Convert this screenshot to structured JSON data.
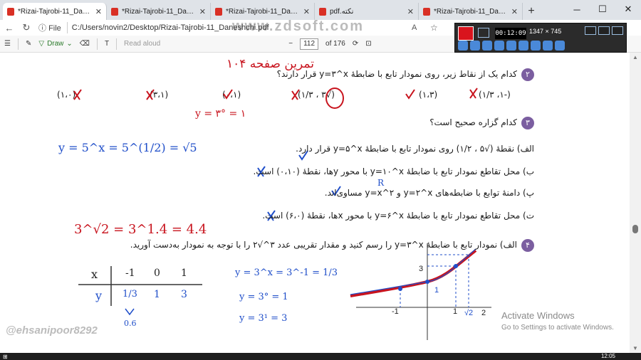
{
  "tabs": [
    {
      "title": "*Rizai-Tajrobi-11_Daneshchi.p",
      "active": true
    },
    {
      "title": "*Rizai-Tajrobi-11_Daneshchi.p",
      "active": false
    },
    {
      "title": "*Rizai-Tajrobi-11_Daneshchi.p",
      "active": false
    },
    {
      "title": "pdf.نکته",
      "active": false
    },
    {
      "title": "*Rizai-Tajrobi-11_Daneshchi.p",
      "active": false
    }
  ],
  "address": {
    "scheme_label": "File",
    "url": "C:/Users/novin2/Desktop/Rizai-Tajrobi-11_Daneshchi.pdf",
    "watermark": "www.zdsoft.com"
  },
  "pdf_toolbar": {
    "draw_label": "Draw",
    "read_aloud": "Read aloud",
    "page_current": "112",
    "page_total": "of 176"
  },
  "recorder": {
    "time": "00:12:09",
    "resolution": "1347 × 745"
  },
  "content": {
    "q2_text": "کدام یک از نقاط زیر، روی نمودار تابع با ضابطهٔ y=۳^x قرار دارند؟",
    "q2_num": "۲",
    "q2_options": [
      "(۱،۰)",
      "(۳،۱)",
      "(۰،۱)",
      "(√۳ ، ۱/۳)",
      "(۱،۳)",
      "(-۱، ۱/۳)"
    ],
    "q3_num": "۳",
    "q3_text": "کدام گزاره صحیح است؟",
    "q3_a": "الف) نقطهٔ (√۵ ، ۱/۲) روی نمودار تابع با ضابطهٔ y=۵^x قرار دارد.",
    "q3_b": "ب) محل تقاطع نمودار تابع با ضابطهٔ y=۱۰^x با محور yها، نقطهٔ (۰،۱۰) است.",
    "q3_p": "پ) دامنهٔ توابع با ضابطه‌های y=۲^x و y=x^۲ مساوی‌اند.",
    "q3_t": "ت) محل تقاطع نمودار تابع با ضابطهٔ y=۶^x با محور xها، نقطهٔ (۶،۰) است.",
    "q4_num": "۴",
    "q4_text": "الف) نمودار تابع با ضابطهٔ y=۳^x را رسم کنید و مقدار تقریبی عدد ۳^√۲ را با توجه به نمودار به‌دست آورید.",
    "hand_title": "تمرین صفحه ۱۰۴",
    "hand_eq1": "y = ۳° = ۱",
    "hand_eq2": "y = 5^x = 5^(1/2) = √5",
    "hand_eq3": "3^√2 = 3^1.4 = 4.4",
    "hand_table_x": [
      "x",
      "-1",
      "0",
      "1"
    ],
    "hand_table_y": [
      "y",
      "1/3",
      "1",
      "3"
    ],
    "hand_eqs": [
      "y = 3^x = 3^-1 = 1/3",
      "y = 3° = 1",
      "y = 3¹ = 3"
    ],
    "hand_approx": "0.6",
    "hand_r": "R",
    "graph_labels": [
      "-1",
      "1",
      "√2",
      "2",
      "3",
      "1"
    ]
  },
  "watermark_handle": "@ehsanipoor8292",
  "activate": {
    "title": "Activate Windows",
    "subtitle": "Go to Settings to activate Windows."
  },
  "taskbar": {
    "time": "12:05"
  }
}
